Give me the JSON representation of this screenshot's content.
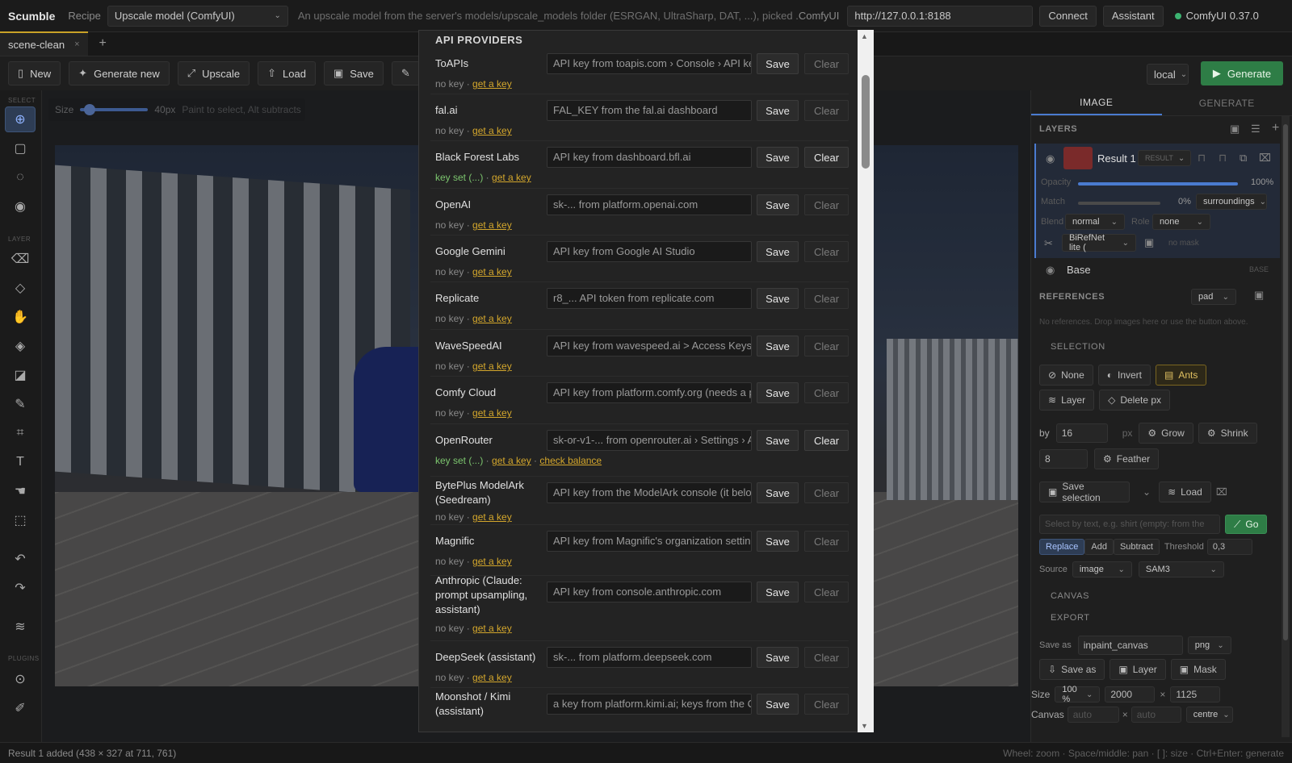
{
  "app": {
    "name": "Scumble",
    "recipe_label": "Recipe",
    "recipe_value": "Upscale model (ComfyUI)",
    "recipe_desc": "An upscale model from the server's models/upscale_models folder (ESRGAN, UltraSharp, DAT, ...), picked ...",
    "comfy_label": "ComfyUI",
    "url": "http://127.0.0.1:8188",
    "connect": "Connect",
    "assistant": "Assistant",
    "version": "ComfyUI 0.37.0"
  },
  "tabs": {
    "doc": "scene-clean",
    "close": "×",
    "add": "+"
  },
  "toolbar": {
    "new": "New",
    "generate_new": "Generate new",
    "upscale": "Upscale",
    "load": "Load",
    "save": "Save",
    "backend": "local",
    "generate": "Generate"
  },
  "lefttools": {
    "select": "SELECT",
    "layer": "LAYER",
    "plugins": "PLUGINS"
  },
  "brush": {
    "label": "Size",
    "value": "40px",
    "hint": "Paint to select, Alt subtracts",
    "level": 0.05
  },
  "modal": {
    "title": "API PROVIDERS",
    "providers": [
      {
        "name": "ToAPIs",
        "placeholder": "API key from toapis.com › Console › API ke",
        "save": "Save",
        "clear": "Clear",
        "status": "no key",
        "link": "get a key",
        "extra": ""
      },
      {
        "name": "fal.ai",
        "placeholder": "FAL_KEY from the fal.ai dashboard",
        "save": "Save",
        "clear": "Clear",
        "status": "no key",
        "link": "get a key",
        "extra": ""
      },
      {
        "name": "Black Forest Labs",
        "placeholder": "API key from dashboard.bfl.ai",
        "save": "Save",
        "clear": "Clear",
        "status": "key set (...)",
        "link": "get a key",
        "extra": ""
      },
      {
        "name": "OpenAI",
        "placeholder": "sk-... from platform.openai.com",
        "save": "Save",
        "clear": "Clear",
        "status": "no key",
        "link": "get a key",
        "extra": ""
      },
      {
        "name": "Google Gemini",
        "placeholder": "API key from Google AI Studio",
        "save": "Save",
        "clear": "Clear",
        "status": "no key",
        "link": "get a key",
        "extra": ""
      },
      {
        "name": "Replicate",
        "placeholder": "r8_... API token from replicate.com",
        "save": "Save",
        "clear": "Clear",
        "status": "no key",
        "link": "get a key",
        "extra": ""
      },
      {
        "name": "WaveSpeedAI",
        "placeholder": "API key from wavespeed.ai > Access Keys (",
        "save": "Save",
        "clear": "Clear",
        "status": "no key",
        "link": "get a key",
        "extra": ""
      },
      {
        "name": "Comfy Cloud",
        "placeholder": "API key from platform.comfy.org (needs a p",
        "save": "Save",
        "clear": "Clear",
        "status": "no key",
        "link": "get a key",
        "extra": ""
      },
      {
        "name": "OpenRouter",
        "placeholder": "sk-or-v1-... from openrouter.ai › Settings › A",
        "save": "Save",
        "clear": "Clear",
        "status": "key set (...)",
        "link": "get a key",
        "extra": "check balance"
      },
      {
        "name": "BytePlus ModelArk (Seedream)",
        "placeholder": "API key from the ModelArk console (it belo",
        "save": "Save",
        "clear": "Clear",
        "status": "no key",
        "link": "get a key",
        "extra": ""
      },
      {
        "name": "Magnific",
        "placeholder": "API key from Magnific's organization settin",
        "save": "Save",
        "clear": "Clear",
        "status": "no key",
        "link": "get a key",
        "extra": ""
      },
      {
        "name": "Anthropic (Claude: prompt upsampling, assistant)",
        "placeholder": "API key from console.anthropic.com",
        "save": "Save",
        "clear": "Clear",
        "status": "no key",
        "link": "get a key",
        "extra": ""
      },
      {
        "name": "DeepSeek (assistant)",
        "placeholder": "sk-... from platform.deepseek.com",
        "save": "Save",
        "clear": "Clear",
        "status": "no key",
        "link": "get a key",
        "extra": ""
      },
      {
        "name": "Moonshot / Kimi (assistant)",
        "placeholder": "a key from platform.kimi.ai; keys from the C",
        "save": "Save",
        "clear": "Clear",
        "status": "",
        "link": "",
        "extra": ""
      }
    ]
  },
  "right": {
    "tab_image": "IMAGE",
    "tab_generate": "GENERATE",
    "layers": "LAYERS",
    "layer1": {
      "name": "Result 1",
      "badge": "RESULT",
      "opacity_label": "Opacity",
      "opacity_value": "100%",
      "match_label": "Match",
      "match_value": "0%",
      "match_mode": "surroundings",
      "blend_label": "Blend",
      "blend_value": "normal",
      "role_label": "Role",
      "role_value": "none",
      "model": "BiRefNet lite (",
      "mask": "no mask"
    },
    "base": {
      "name": "Base",
      "badge": "BASE"
    },
    "references": "REFERENCES",
    "ref_mode": "pad",
    "ref_hint": "No references. Drop images here or use the button above.",
    "selection": "SELECTION",
    "sel_none": "None",
    "sel_invert": "Invert",
    "sel_ants": "Ants",
    "sel_layer": "Layer",
    "sel_delete": "Delete px",
    "by_label": "by",
    "by_value": "16",
    "px": "px",
    "grow": "Grow",
    "shrink": "Shrink",
    "feather_value": "8",
    "feather": "Feather",
    "save_selection": "Save selection",
    "load": "Load",
    "select_placeholder": "Select by text, e.g. shirt (empty: from the",
    "go": "Go",
    "replace": "Replace",
    "add": "Add",
    "subtract": "Subtract",
    "threshold_label": "Threshold",
    "threshold_value": "0,3",
    "source_label": "Source",
    "source_value": "image",
    "model_value": "SAM3",
    "canvas": "CANVAS",
    "export": "EXPORT",
    "save_as_label": "Save as",
    "save_as_value": "inpaint_canvas",
    "format": "png",
    "save_as_btn": "Save as",
    "layer_btn": "Layer",
    "mask_btn": "Mask",
    "size_label": "Size",
    "size_pct": "100 %",
    "width": "2000",
    "x": "×",
    "height": "1125",
    "canvas_label": "Canvas",
    "canvas_w": "auto",
    "canvas_h": "auto",
    "anchor": "centre"
  },
  "status": {
    "left": "Result 1 added (438 × 327 at 711, 761)",
    "right": "Wheel: zoom · Space/middle: pan · [ ]: size · Ctrl+Enter: generate"
  }
}
